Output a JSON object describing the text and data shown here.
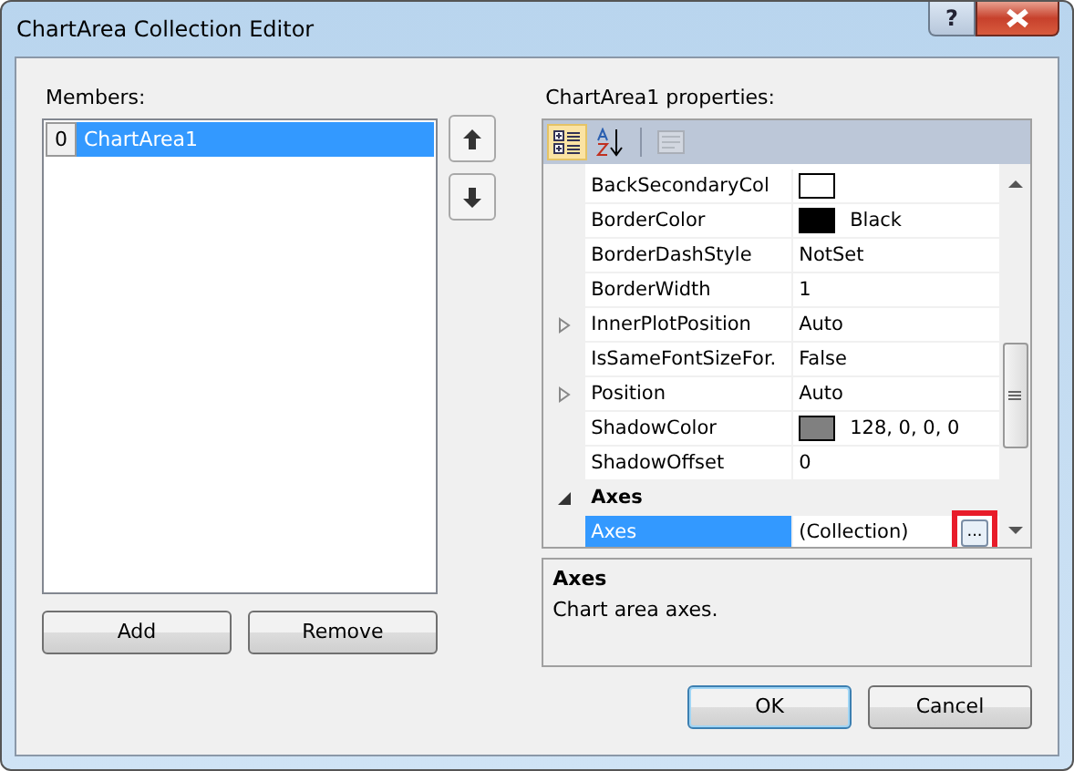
{
  "window": {
    "title": "ChartArea Collection Editor",
    "help_button": "?"
  },
  "members": {
    "label": "Members:",
    "items": [
      {
        "index": "0",
        "name": "ChartArea1",
        "selected": true
      }
    ]
  },
  "buttons_left": [
    "Add",
    "Remove"
  ],
  "properties": {
    "label": "ChartArea1 properties:",
    "toolbar": [
      {
        "kind": "categorized",
        "selected": true,
        "disabled": false
      },
      {
        "kind": "alphabetical",
        "selected": false,
        "disabled": false
      },
      {
        "kind": "pages",
        "selected": false,
        "disabled": true
      }
    ],
    "rows": [
      {
        "kind": "property",
        "name": "BackSecondaryCol",
        "value": "",
        "color": "#ffffff",
        "expandable": false,
        "selected": false
      },
      {
        "kind": "property",
        "name": "BorderColor",
        "value": "Black",
        "color": "#000000",
        "expandable": false,
        "selected": false
      },
      {
        "kind": "property",
        "name": "BorderDashStyle",
        "value": "NotSet",
        "expandable": false,
        "selected": false
      },
      {
        "kind": "property",
        "name": "BorderWidth",
        "value": "1",
        "expandable": false,
        "selected": false
      },
      {
        "kind": "property",
        "name": "InnerPlotPosition",
        "value": "Auto",
        "expandable": true,
        "selected": false
      },
      {
        "kind": "property",
        "name": "IsSameFontSizeFor.",
        "value": "False",
        "expandable": false,
        "selected": false
      },
      {
        "kind": "property",
        "name": "Position",
        "value": "Auto",
        "expandable": true,
        "selected": false
      },
      {
        "kind": "property",
        "name": "ShadowColor",
        "value": "128, 0, 0, 0",
        "color": "#808080",
        "expandable": false,
        "selected": false
      },
      {
        "kind": "property",
        "name": "ShadowOffset",
        "value": "0",
        "expandable": false,
        "selected": false
      },
      {
        "kind": "category",
        "name": "Axes",
        "expanded": true
      },
      {
        "kind": "property",
        "name": "Axes",
        "value": "(Collection)",
        "expandable": false,
        "selected": true,
        "ellipsis": {
          "label": "...",
          "highlighted": true
        }
      }
    ],
    "description": {
      "title": "Axes",
      "text": "Chart area axes."
    }
  },
  "buttons_right": [
    "OK",
    "Cancel"
  ]
}
